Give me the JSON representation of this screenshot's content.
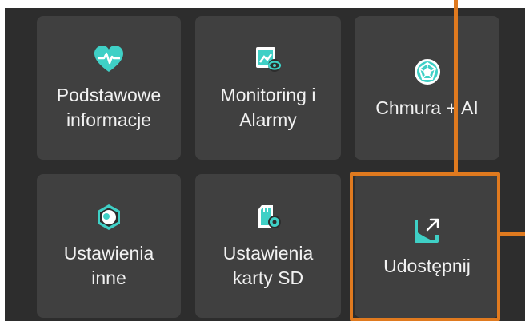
{
  "tiles": [
    {
      "label": "Podstawowe\ninformacje",
      "icon": "heart-pulse-icon"
    },
    {
      "label": "Monitoring i\nAlarmy",
      "icon": "monitor-eye-icon"
    },
    {
      "label": "Chmura + AI",
      "icon": "cloud-ai-polyhedron-icon"
    },
    {
      "label": "Ustawienia\ninne",
      "icon": "settings-hex-icon"
    },
    {
      "label": "Ustawienia\nkarty SD",
      "icon": "sd-card-settings-icon"
    },
    {
      "label": "Udostępnij",
      "icon": "share-icon"
    }
  ],
  "colors": {
    "panel": "#2d2d2d",
    "tile": "#404040",
    "icon_accent": "#3fd0c6",
    "highlight": "#e07a1f"
  }
}
